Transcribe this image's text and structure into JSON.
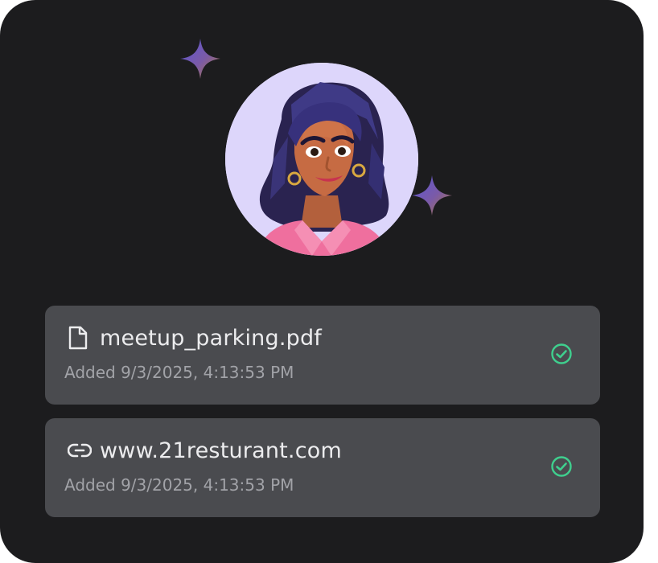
{
  "avatar": {
    "icon": "avatar-portrait-woman"
  },
  "decorations": {
    "sparkle_icon": "sparkle-icon",
    "sparkle_color": "#6b5bd6"
  },
  "items": [
    {
      "icon": "file-icon",
      "title": "meetup_parking.pdf",
      "meta": "Added 9/3/2025, 4:13:53 PM",
      "status_icon": "check-circle-icon"
    },
    {
      "icon": "link-icon",
      "title": "www.21resturant.com",
      "meta": "Added 9/3/2025, 4:13:53 PM",
      "status_icon": "check-circle-icon"
    }
  ],
  "colors": {
    "card_bg": "#1c1c1e",
    "item_bg": "#4a4b4f",
    "title_text": "#ececee",
    "meta_text": "#a2a3a8",
    "success": "#3fcf8e",
    "avatar_bg": "#ddd6fb"
  }
}
